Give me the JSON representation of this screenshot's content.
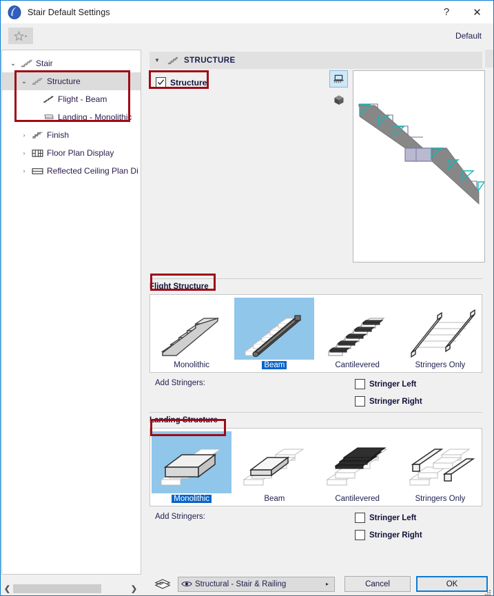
{
  "window": {
    "title": "Stair Default Settings",
    "app_icon": "archicad-logo-icon",
    "help_label": "?",
    "close_label": "✕"
  },
  "toolbar": {
    "favorites_icon": "star-icon",
    "favorites_arrow": "▸",
    "default_label": "Default"
  },
  "sidebar": {
    "items": [
      {
        "label": "Stair",
        "icon": "stair-icon",
        "twisty": "⌄",
        "depth": 0,
        "selected": false
      },
      {
        "label": "Structure",
        "icon": "structure-icon",
        "twisty": "⌄",
        "depth": 1,
        "selected": true
      },
      {
        "label": "Flight - Beam",
        "icon": "flight-beam-icon",
        "twisty": "",
        "depth": 2,
        "selected": false
      },
      {
        "label": "Landing - Monolithic",
        "icon": "landing-icon",
        "twisty": "",
        "depth": 2,
        "selected": false
      },
      {
        "label": "Finish",
        "icon": "finish-icon",
        "twisty": "›",
        "depth": 1,
        "selected": false
      },
      {
        "label": "Floor Plan Display",
        "icon": "floor-plan-icon",
        "twisty": "›",
        "depth": 1,
        "selected": false
      },
      {
        "label": "Reflected Ceiling Plan Di",
        "icon": "ceiling-plan-icon",
        "twisty": "›",
        "depth": 1,
        "selected": false
      }
    ],
    "scroll_left_arrow": "❮",
    "scroll_right_arrow": "❯"
  },
  "section": {
    "caret": "▼",
    "icon": "structure-icon",
    "title": "STRUCTURE",
    "structure_checkbox_label": "Structure",
    "structure_checked": true
  },
  "preview": {
    "view_buttons": [
      {
        "icon": "elevation-view-icon",
        "active": true
      },
      {
        "icon": "3d-view-icon",
        "active": false
      }
    ]
  },
  "flight_structure": {
    "group_label": "Flight Structure",
    "options": [
      {
        "label": "Monolithic",
        "icon": "stair-monolithic-icon",
        "selected": false
      },
      {
        "label": "Beam",
        "icon": "stair-beam-icon",
        "selected": true
      },
      {
        "label": "Cantilevered",
        "icon": "stair-cantilevered-icon",
        "selected": false
      },
      {
        "label": "Stringers Only",
        "icon": "stair-stringers-icon",
        "selected": false
      }
    ],
    "add_stringers_label": "Add Stringers:",
    "stringers": [
      {
        "label": "Stringer Left",
        "checked": false
      },
      {
        "label": "Stringer Right",
        "checked": false
      }
    ]
  },
  "landing_structure": {
    "group_label": "Landing Structure",
    "options": [
      {
        "label": "Monolithic",
        "icon": "landing-monolithic-icon",
        "selected": true
      },
      {
        "label": "Beam",
        "icon": "landing-beam-icon",
        "selected": false
      },
      {
        "label": "Cantilevered",
        "icon": "landing-cantilevered-icon",
        "selected": false
      },
      {
        "label": "Stringers Only",
        "icon": "landing-stringers-icon",
        "selected": false
      }
    ],
    "add_stringers_label": "Add Stringers:",
    "stringers": [
      {
        "label": "Stringer Left",
        "checked": false
      },
      {
        "label": "Stringer Right",
        "checked": false
      }
    ]
  },
  "footer": {
    "layers_icon": "layers-icon",
    "layer_combo_icon": "eye-icon",
    "layer_combo_value": "Structural - Stair & Railing",
    "layer_combo_arrow": "▸",
    "cancel_label": "Cancel",
    "ok_label": "OK"
  },
  "annotations": {
    "color": "#9e0b14",
    "boxes": [
      {
        "name": "sidebar-structure-group-highlight"
      },
      {
        "name": "structure-checkbox-highlight"
      },
      {
        "name": "flight-structure-label-highlight"
      },
      {
        "name": "landing-structure-label-highlight"
      }
    ]
  }
}
